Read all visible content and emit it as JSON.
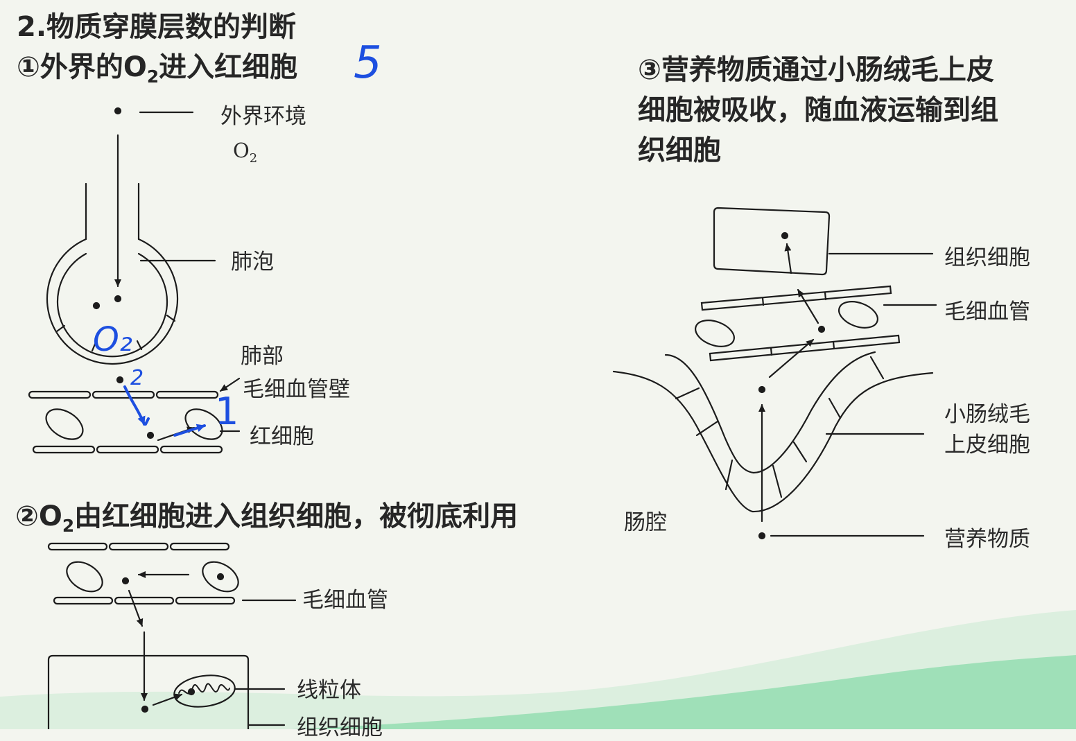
{
  "heading": {
    "section": "2.物质穿膜层数的判断",
    "case1_prefix": "①外界的O",
    "case1_sub": "2",
    "case1_suffix": "进入红细胞",
    "case2_prefix": "②O",
    "case2_sub": "2",
    "case2_suffix": "由红细胞进入组织细胞，被彻底利用",
    "case3_lines": [
      "③营养物质通过小肠绒毛上皮",
      "细胞被吸收，随血液运输到组",
      "织细胞"
    ]
  },
  "diagram1": {
    "labels": {
      "environment": "外界环境",
      "o2": "O",
      "o2_sub": "2",
      "alveolus": "肺泡",
      "lung": "肺部",
      "capillary_wall": "毛细血管壁",
      "red_cell": "红细胞"
    }
  },
  "diagram2": {
    "labels": {
      "capillary": "毛细血管",
      "mitochondria": "线粒体",
      "tissue_cell": "组织细胞"
    }
  },
  "diagram3": {
    "labels": {
      "tissue_cell": "组织细胞",
      "capillary": "毛细血管",
      "villus_epithelium_lines": [
        "小肠绒毛",
        "上皮细胞"
      ],
      "intestine_lumen": "肠腔",
      "nutrients": "营养物质"
    }
  },
  "annotations": {
    "count_answer": "5",
    "handwritten_o2": "O₂",
    "handwritten_2": "2",
    "handwritten_1": "1"
  },
  "colors": {
    "ink": "#1c1c1c",
    "handwriting": "#1d4fe0",
    "background": "#f3f5ef",
    "wave_accent": "#8fdcad"
  }
}
